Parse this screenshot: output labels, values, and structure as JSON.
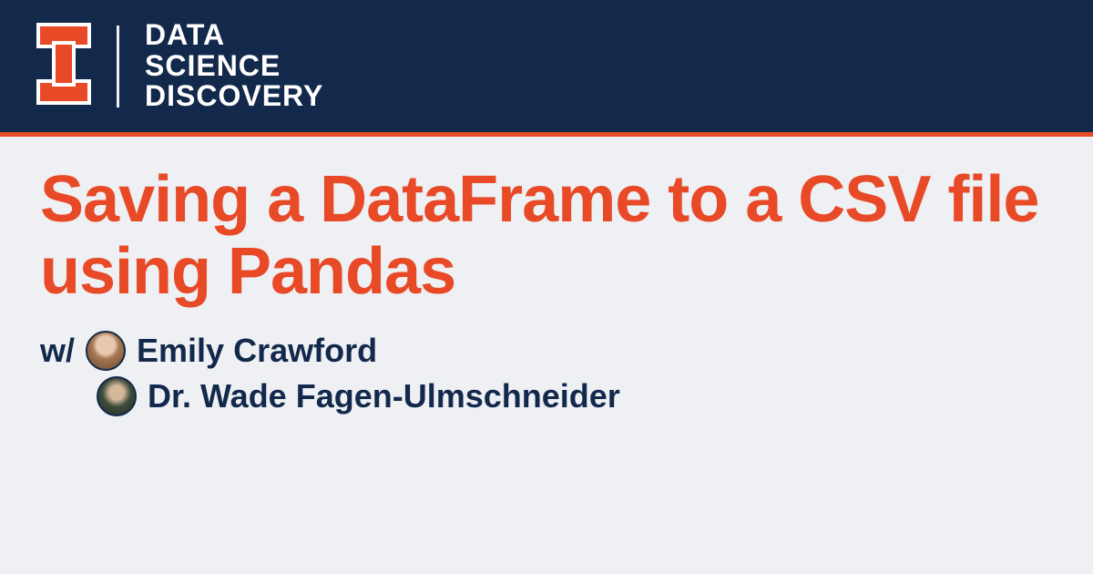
{
  "brand": {
    "line1": "DATA",
    "line2": "SCIENCE",
    "line3": "DISCOVERY"
  },
  "title": "Saving a DataFrame to a CSV file using Pandas",
  "authors": {
    "prefix": "w/",
    "list": [
      {
        "name": "Emily Crawford"
      },
      {
        "name": "Dr. Wade Fagen-Ulmschneider"
      }
    ]
  },
  "colors": {
    "navy": "#13294b",
    "orange": "#e84a27",
    "background": "#eef0f4"
  }
}
